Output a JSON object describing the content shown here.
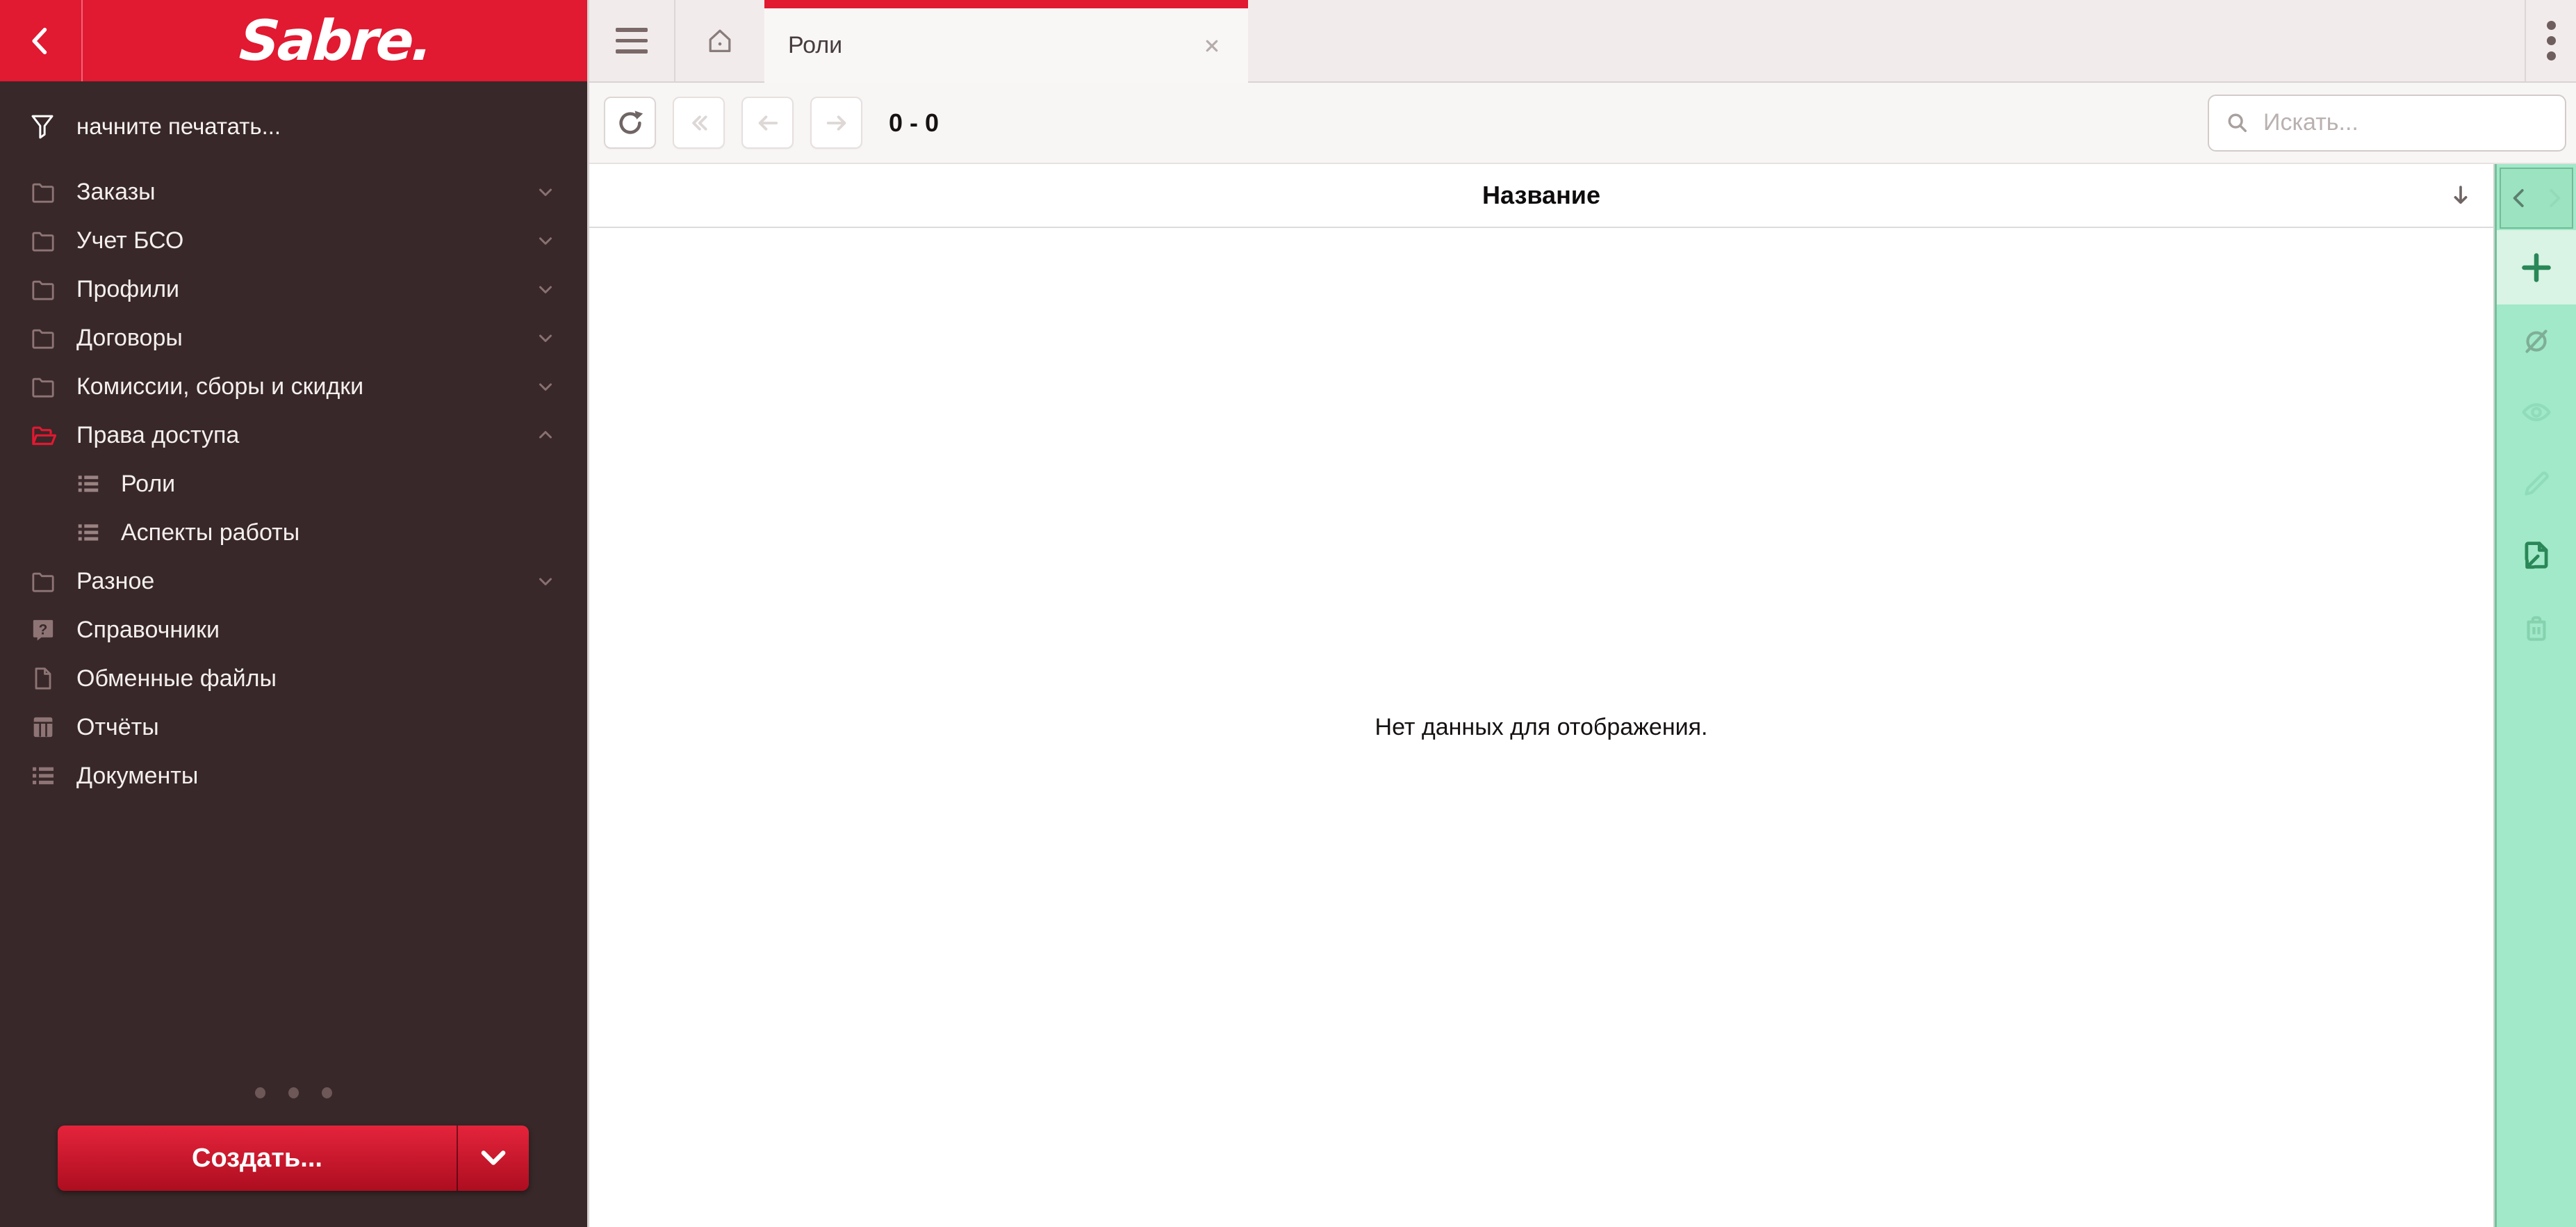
{
  "colors": {
    "brand_red": "#e11931",
    "sidebar_bg": "#382829",
    "panel_green_bg": "#a1e9c9",
    "panel_green_light": "#d9f3e5",
    "panel_green_dark": "#2a8757"
  },
  "sidebar": {
    "logo_text": "Sabre.",
    "back_icon": "chevron-left-icon",
    "filter": {
      "icon": "filter-funnel-icon",
      "placeholder": "начните печатать..."
    },
    "items": [
      {
        "label": "Заказы",
        "icon": "folder-icon",
        "chevron": "down"
      },
      {
        "label": "Учет БСО",
        "icon": "folder-icon",
        "chevron": "down"
      },
      {
        "label": "Профили",
        "icon": "folder-icon",
        "chevron": "down"
      },
      {
        "label": "Договоры",
        "icon": "folder-icon",
        "chevron": "down"
      },
      {
        "label": "Комиссии, сборы и скидки",
        "icon": "folder-icon",
        "chevron": "down"
      },
      {
        "label": "Права доступа",
        "icon": "folder-open-icon",
        "chevron": "up",
        "active": true
      },
      {
        "label": "Роли",
        "icon": "list-icon",
        "indent": true
      },
      {
        "label": "Аспекты работы",
        "icon": "list-icon",
        "indent": true
      },
      {
        "label": "Разное",
        "icon": "folder-icon",
        "chevron": "down"
      },
      {
        "label": "Справочники",
        "icon": "reference-book-icon"
      },
      {
        "label": "Обменные файлы",
        "icon": "file-icon"
      },
      {
        "label": "Отчёты",
        "icon": "report-grid-icon"
      },
      {
        "label": "Документы",
        "icon": "list-icon"
      }
    ],
    "page_indicator_dots": 3,
    "create_button": {
      "label": "Создать...",
      "dropdown_icon": "chevron-down-icon"
    }
  },
  "topbar": {
    "menu_icon": "hamburger-icon",
    "home_icon": "home-icon",
    "tab": {
      "title": "Роли",
      "close_icon": "close-icon",
      "accent_color": "#e11931"
    },
    "overflow_icon": "kebab-menu-icon"
  },
  "toolbar": {
    "refresh_icon": "refresh-icon",
    "pager": {
      "first_icon": "double-chevron-left-icon",
      "prev_icon": "arrow-left-icon",
      "next_icon": "arrow-right-icon",
      "range_text": "0 - 0"
    },
    "search": {
      "icon": "search-icon",
      "placeholder": "Искать..."
    }
  },
  "table": {
    "header": "Название",
    "sort_icon": "arrow-down-icon",
    "empty_message": "Нет данных для отображения."
  },
  "action_panel": {
    "collapse_icon": "chevron-left-icon",
    "expand_icon": "chevron-right-icon",
    "actions": [
      {
        "name": "add",
        "icon": "plus-icon",
        "state": "highlighted"
      },
      {
        "name": "deactivate",
        "icon": "eye-off-icon",
        "state": "disabled"
      },
      {
        "name": "view",
        "icon": "eye-icon",
        "state": "disabled"
      },
      {
        "name": "edit",
        "icon": "pencil-icon",
        "state": "disabled"
      },
      {
        "name": "import",
        "icon": "import-file-icon",
        "state": "enabled"
      },
      {
        "name": "delete",
        "icon": "trash-icon",
        "state": "disabled"
      }
    ]
  }
}
